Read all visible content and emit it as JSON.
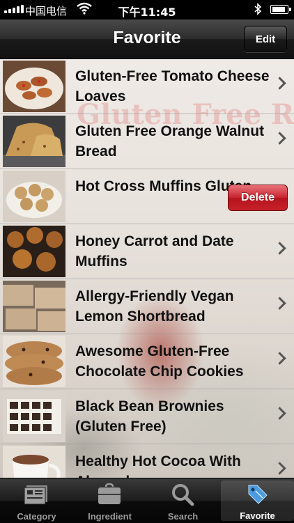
{
  "status_bar": {
    "carrier": "中国电信",
    "time": "下午11:45"
  },
  "nav": {
    "title": "Favorite",
    "edit_label": "Edit"
  },
  "background": {
    "watermark": "Gluten Free Recipes"
  },
  "recipes": [
    {
      "name": "Gluten-Free Tomato Cheese Loaves",
      "thumb_icon": "tomato-cheese-loaves-photo",
      "thumb_color": "#b8642f"
    },
    {
      "name": "Gluten Free Orange Walnut Bread",
      "thumb_icon": "orange-walnut-bread-photo",
      "thumb_color": "#c89a55"
    },
    {
      "name": "Hot Cross Muffins Gluten...",
      "thumb_icon": "hot-cross-muffins-photo",
      "thumb_color": "#c9b28a",
      "delete_label": "Delete"
    },
    {
      "name": "Honey Carrot and Date Muffins",
      "thumb_icon": "carrot-date-muffins-photo",
      "thumb_color": "#a8652a"
    },
    {
      "name": "Allergy-Friendly Vegan Lemon Shortbread",
      "thumb_icon": "lemon-shortbread-photo",
      "thumb_color": "#c9b092"
    },
    {
      "name": "Awesome Gluten-Free Chocolate Chip Cookies",
      "thumb_icon": "chocolate-chip-cookies-photo",
      "thumb_color": "#b98350"
    },
    {
      "name": "Black Bean Brownies (Gluten Free)",
      "thumb_icon": "black-bean-brownies-photo",
      "thumb_color": "#3a2a22"
    },
    {
      "name": "Healthy Hot Cocoa With Almond...",
      "thumb_icon": "hot-cocoa-photo",
      "thumb_color": "#7a4a30"
    }
  ],
  "tabs": [
    {
      "label": "Category",
      "icon": "category-icon"
    },
    {
      "label": "Ingredient",
      "icon": "ingredient-icon"
    },
    {
      "label": "Search",
      "icon": "search-icon"
    },
    {
      "label": "Favorite",
      "icon": "favorite-tag-icon",
      "active": true
    }
  ],
  "colors": {
    "delete_red": "#c8232d",
    "tab_active_icon": "#4a9be0"
  }
}
